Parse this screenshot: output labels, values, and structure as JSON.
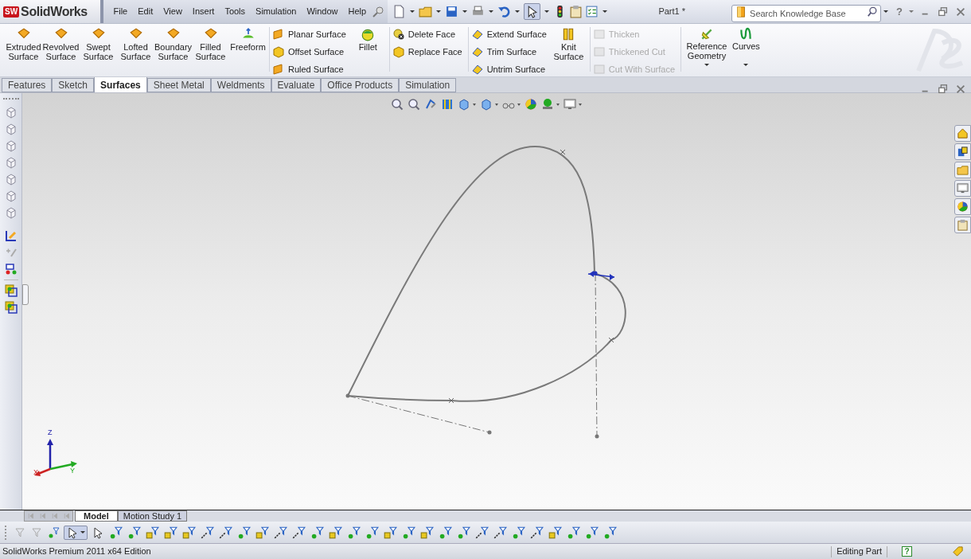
{
  "app": {
    "logo_badge": "SW",
    "logo": "SolidWorks"
  },
  "menu": [
    "File",
    "Edit",
    "View",
    "Insert",
    "Tools",
    "Simulation",
    "Window",
    "Help"
  ],
  "document_title": "Part1 *",
  "search": {
    "placeholder": "Search Knowledge Base"
  },
  "title_buttons": [
    "?"
  ],
  "ribbon": [
    {
      "kind": "large",
      "label": "Extruded Surface",
      "disabled": false
    },
    {
      "kind": "large",
      "label": "Revolved Surface",
      "disabled": false
    },
    {
      "kind": "large",
      "label": "Swept Surface",
      "disabled": false
    },
    {
      "kind": "large",
      "label": "Lofted Surface",
      "disabled": false
    },
    {
      "kind": "large",
      "label": "Boundary Surface",
      "disabled": false
    },
    {
      "kind": "large",
      "label": "Filled Surface",
      "disabled": false
    },
    {
      "kind": "large",
      "label": "Freeform",
      "disabled": false
    },
    {
      "kind": "separator"
    },
    {
      "kind": "stack",
      "items": [
        {
          "label": "Planar Surface",
          "disabled": false
        },
        {
          "label": "Offset Surface",
          "disabled": false
        },
        {
          "label": "Ruled Surface",
          "disabled": false
        }
      ]
    },
    {
      "kind": "large",
      "label": "Fillet",
      "disabled": false
    },
    {
      "kind": "separator"
    },
    {
      "kind": "stack",
      "items": [
        {
          "label": "Delete Face",
          "disabled": false
        },
        {
          "label": "Replace Face",
          "disabled": false
        }
      ]
    },
    {
      "kind": "separator"
    },
    {
      "kind": "stack",
      "items": [
        {
          "label": "Extend Surface",
          "disabled": false
        },
        {
          "label": "Trim Surface",
          "disabled": false
        },
        {
          "label": "Untrim Surface",
          "disabled": false
        }
      ]
    },
    {
      "kind": "large",
      "label": "Knit Surface",
      "disabled": false
    },
    {
      "kind": "separator"
    },
    {
      "kind": "stack",
      "items": [
        {
          "label": "Thicken",
          "disabled": true
        },
        {
          "label": "Thickened Cut",
          "disabled": true
        },
        {
          "label": "Cut With Surface",
          "disabled": true
        }
      ]
    },
    {
      "kind": "separator"
    },
    {
      "kind": "dropdown",
      "label": "Reference Geometry",
      "disabled": false
    },
    {
      "kind": "dropdown",
      "label": "Curves",
      "disabled": false
    }
  ],
  "tabs": [
    {
      "label": "Features",
      "selected": false
    },
    {
      "label": "Sketch",
      "selected": false
    },
    {
      "label": "Surfaces",
      "selected": true
    },
    {
      "label": "Sheet Metal",
      "selected": false
    },
    {
      "label": "Weldments",
      "selected": false
    },
    {
      "label": "Evaluate",
      "selected": false
    },
    {
      "label": "Office Products",
      "selected": false
    },
    {
      "label": "Simulation",
      "selected": false
    }
  ],
  "triad": {
    "z": "Z",
    "x": "X",
    "y": "Y"
  },
  "bottom_tabs": [
    {
      "label": "Model",
      "selected": true
    },
    {
      "label": "Motion Study 1",
      "selected": false
    }
  ],
  "status_bar": {
    "edition": "SolidWorks Premium 2011 x64 Edition",
    "mode": "Editing Part",
    "help": "?"
  }
}
